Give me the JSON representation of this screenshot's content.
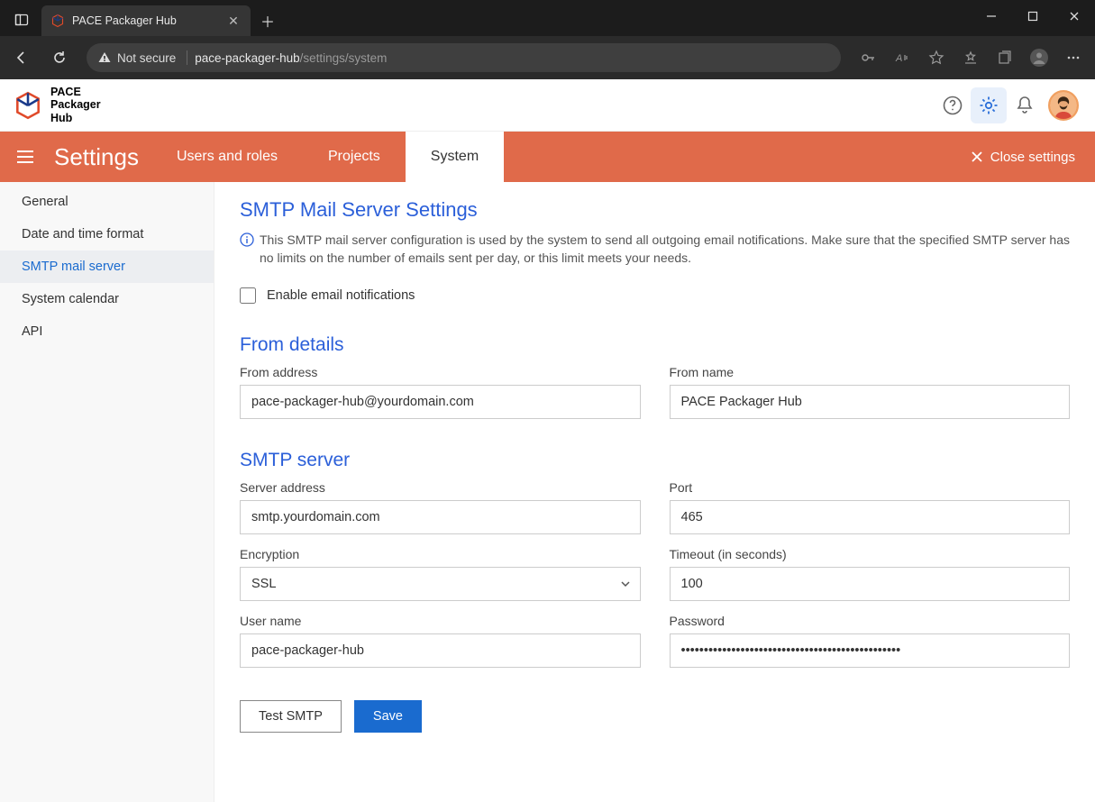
{
  "browser": {
    "tab_title": "PACE Packager Hub",
    "not_secure_label": "Not secure",
    "url_host": "pace-packager-hub",
    "url_path": "/settings/system"
  },
  "app": {
    "logo_line1": "PACE",
    "logo_line2": "Packager",
    "logo_line3": "Hub"
  },
  "settings_bar": {
    "title": "Settings",
    "tabs": [
      "Users and roles",
      "Projects",
      "System"
    ],
    "close_label": "Close settings"
  },
  "sidebar": {
    "items": [
      "General",
      "Date and time format",
      "SMTP mail server",
      "System calendar",
      "API"
    ],
    "active_index": 2
  },
  "page": {
    "h_smtp": "SMTP Mail Server Settings",
    "info_text": "This SMTP mail server configuration is used by the system to send all outgoing email notifications. Make sure that the specified SMTP server has no limits on the number of emails sent per day, or this limit meets your needs.",
    "enable_label": "Enable email notifications",
    "h_from": "From details",
    "from_address_label": "From address",
    "from_address_value": "pace-packager-hub@yourdomain.com",
    "from_name_label": "From name",
    "from_name_value": "PACE Packager Hub",
    "h_server": "SMTP server",
    "server_address_label": "Server address",
    "server_address_value": "smtp.yourdomain.com",
    "port_label": "Port",
    "port_value": "465",
    "encryption_label": "Encryption",
    "encryption_value": "SSL",
    "timeout_label": "Timeout (in seconds)",
    "timeout_value": "100",
    "username_label": "User name",
    "username_value": "pace-packager-hub",
    "password_label": "Password",
    "password_value": "••••••••••••••••••••••••••••••••••••••••••••••••",
    "test_label": "Test SMTP",
    "save_label": "Save"
  }
}
